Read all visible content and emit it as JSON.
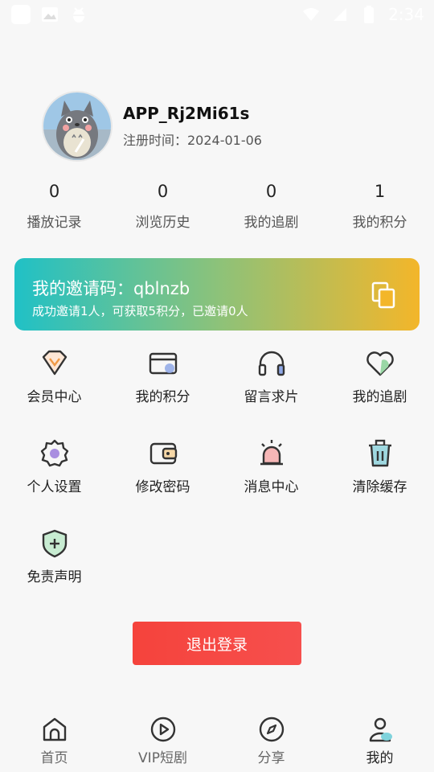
{
  "status_bar": {
    "time": "2:34"
  },
  "profile": {
    "username": "APP_Rj2Mi61s",
    "reg_label": "注册时间：2024-01-06"
  },
  "stats": [
    {
      "value": "0",
      "label": "播放记录"
    },
    {
      "value": "0",
      "label": "浏览历史"
    },
    {
      "value": "0",
      "label": "我的追剧"
    },
    {
      "value": "1",
      "label": "我的积分"
    }
  ],
  "invite": {
    "title": "我的邀请码：qblnzb",
    "subtitle": "成功邀请1人，可获取5积分，已邀请0人"
  },
  "grid": [
    {
      "label": "会员中心",
      "icon": "vip-diamond-icon"
    },
    {
      "label": "我的积分",
      "icon": "card-icon"
    },
    {
      "label": "留言求片",
      "icon": "headphones-icon"
    },
    {
      "label": "我的追剧",
      "icon": "heart-icon"
    },
    {
      "label": "个人设置",
      "icon": "gear-icon"
    },
    {
      "label": "修改密码",
      "icon": "wallet-icon"
    },
    {
      "label": "消息中心",
      "icon": "alarm-icon"
    },
    {
      "label": "清除缓存",
      "icon": "trash-icon"
    },
    {
      "label": "免责声明",
      "icon": "shield-icon"
    }
  ],
  "logout_label": "退出登录",
  "tabs": [
    {
      "label": "首页",
      "icon": "home-icon",
      "active": false
    },
    {
      "label": "VIP短剧",
      "icon": "play-icon",
      "active": false
    },
    {
      "label": "分享",
      "icon": "compass-icon",
      "active": false
    },
    {
      "label": "我的",
      "icon": "user-icon",
      "active": true
    }
  ],
  "colors": {
    "accent_start": "#20c1c6",
    "accent_end": "#f3b62a",
    "logout": "#f5433c"
  }
}
